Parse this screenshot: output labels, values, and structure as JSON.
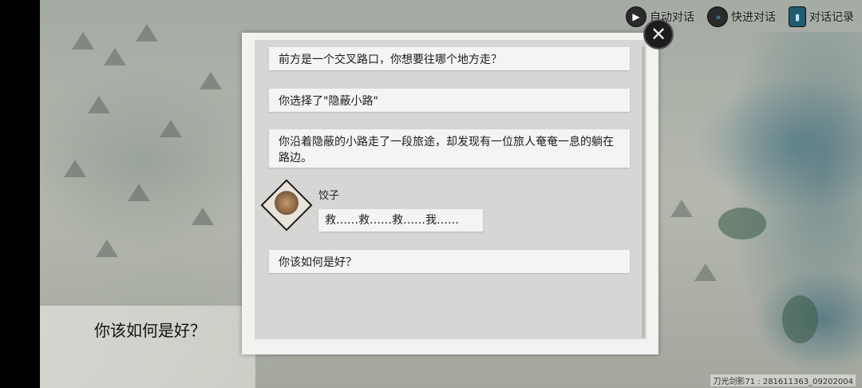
{
  "controls": {
    "auto_dialogue": "自动对话",
    "fast_dialogue": "快进对话",
    "dialogue_log": "对话记录"
  },
  "icons": {
    "auto": "play-icon",
    "fast": "fast-forward-icon",
    "log": "book-icon",
    "close": "close-icon"
  },
  "dialog_log": {
    "entries": [
      "前方是一个交叉路口，你想要往哪个地方走？",
      "你选择了\"隐蔽小路\"",
      "你沿着隐蔽的小路走了一段旅途，却发现有一位旅人奄奄一息的躺在路边。",
      "你该如何是好？"
    ],
    "speaker": {
      "name": "饺子",
      "line": "救……救……救……我……"
    }
  },
  "prompt": "你该如何是好？",
  "watermark": "刀光剑影71 : 281611363_09202004"
}
